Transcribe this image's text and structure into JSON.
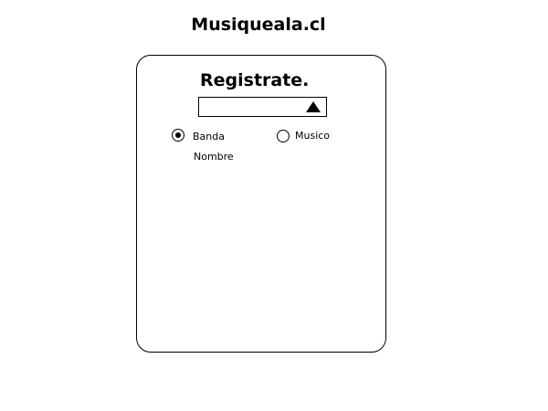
{
  "header": {
    "site_title": "Musiqueala.cl"
  },
  "form": {
    "heading": "Registrate.",
    "dropdown": {
      "value": ""
    },
    "account_type": {
      "selected": "Banda",
      "options": [
        {
          "label": "Banda",
          "checked": true
        },
        {
          "label": "Musico",
          "checked": false
        }
      ]
    },
    "name_label": "Nombre"
  }
}
